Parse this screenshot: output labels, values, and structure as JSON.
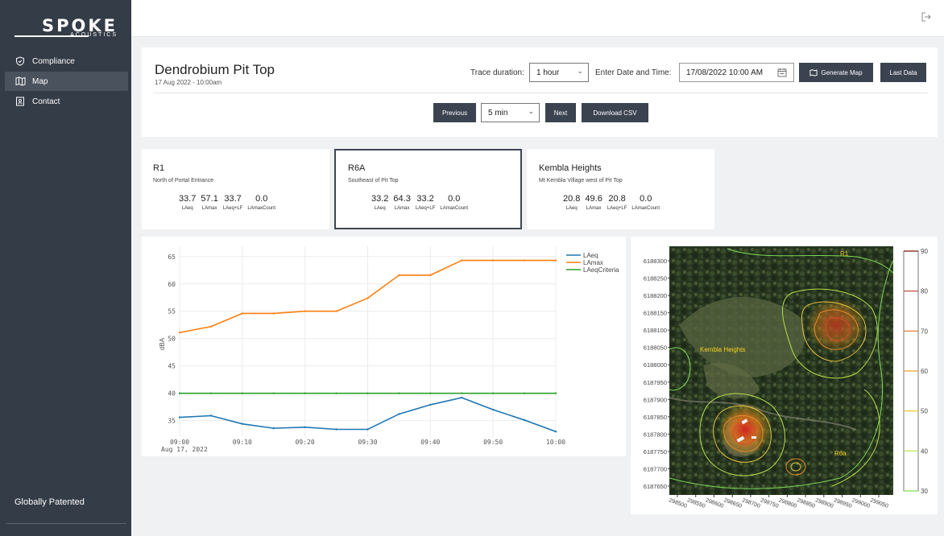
{
  "sidebar": {
    "logo": {
      "brand": "SPOKE",
      "sub": "ACOUSTICS"
    },
    "items": [
      {
        "label": "Compliance",
        "icon": "shield-check-icon"
      },
      {
        "label": "Map",
        "icon": "map-icon"
      },
      {
        "label": "Contact",
        "icon": "contact-card-icon"
      }
    ],
    "active_item": "Map",
    "footer": "Globally Patented"
  },
  "topbar": {
    "logout_icon": "logout-icon"
  },
  "header": {
    "title": "Dendrobium Pit Top",
    "subtitle": "17 Aug 2022 - 10:00am",
    "trace_label": "Trace duration:",
    "trace_value": "1 hour",
    "date_label": "Enter Date and Time:",
    "date_value": "17/08/2022 10:00 AM",
    "generate_map": "Generate Map",
    "last_data": "Last Data",
    "previous": "Previous",
    "step_value": "5 min",
    "next": "Next",
    "download": "Download CSV"
  },
  "receivers": [
    {
      "name": "R1",
      "desc": "North of Portal Entrance",
      "values": [
        "33.7",
        "57.1",
        "33.7",
        "0.0"
      ],
      "selected": false
    },
    {
      "name": "R6A",
      "desc": "Southeast of Pit Top",
      "values": [
        "33.2",
        "64.3",
        "33.2",
        "0.0"
      ],
      "selected": true
    },
    {
      "name": "Kembla Heights",
      "desc": "Mt Kembla Village west of Pit Top",
      "values": [
        "20.8",
        "49.6",
        "20.8",
        "0.0"
      ],
      "selected": false
    }
  ],
  "metric_units": [
    "LAeq",
    "LAmax",
    "LAeq+LF",
    "LAmaxCount"
  ],
  "chart_data": [
    {
      "type": "line",
      "ylabel": "dBA",
      "ylim": [
        32,
        66
      ],
      "x": [
        "09:00",
        "09:05",
        "09:10",
        "09:15",
        "09:20",
        "09:25",
        "09:30",
        "09:35",
        "09:40",
        "09:45",
        "09:50",
        "09:55",
        "10:00"
      ],
      "x_ticks": [
        "09:00",
        "09:10",
        "09:20",
        "09:30",
        "09:40",
        "09:50",
        "10:00"
      ],
      "x_subtitle": "Aug 17, 2022",
      "y_ticks": [
        35,
        40,
        45,
        50,
        55,
        60,
        65
      ],
      "series": [
        {
          "name": "LAeq",
          "color": "#1f77b4",
          "values": [
            35.6,
            35.9,
            34.4,
            33.6,
            33.8,
            33.4,
            33.4,
            36.2,
            37.9,
            39.2,
            37.0,
            35.1,
            33.0
          ]
        },
        {
          "name": "LAmax",
          "color": "#ff7f0e",
          "values": [
            51.1,
            52.2,
            54.6,
            54.6,
            55.0,
            55.0,
            57.4,
            61.6,
            61.6,
            64.3,
            64.3,
            64.3,
            64.3
          ]
        },
        {
          "name": "LAeqCriteria",
          "color": "#2ca02c",
          "values": [
            40,
            40,
            40,
            40,
            40,
            40,
            40,
            40,
            40,
            40,
            40,
            40,
            40
          ]
        }
      ],
      "legend": "top-right",
      "grid": true
    },
    {
      "type": "heatmap",
      "y_ticks": [
        "6188300",
        "6188250",
        "6188200",
        "6188150",
        "6188100",
        "6188050",
        "6188000",
        "6187950",
        "6187900",
        "6187850",
        "6187800",
        "6187750",
        "6187700",
        "6187650"
      ],
      "x_ticks": [
        "298500",
        "298550",
        "298600",
        "298650",
        "298700",
        "298750",
        "298800",
        "298850",
        "298900",
        "298950",
        "299000",
        "299050"
      ],
      "colorbar_ticks": [
        "90",
        "80",
        "70",
        "60",
        "50",
        "40",
        "30"
      ],
      "labels": [
        "R1",
        "Kembla Heights",
        "R6a"
      ]
    }
  ]
}
